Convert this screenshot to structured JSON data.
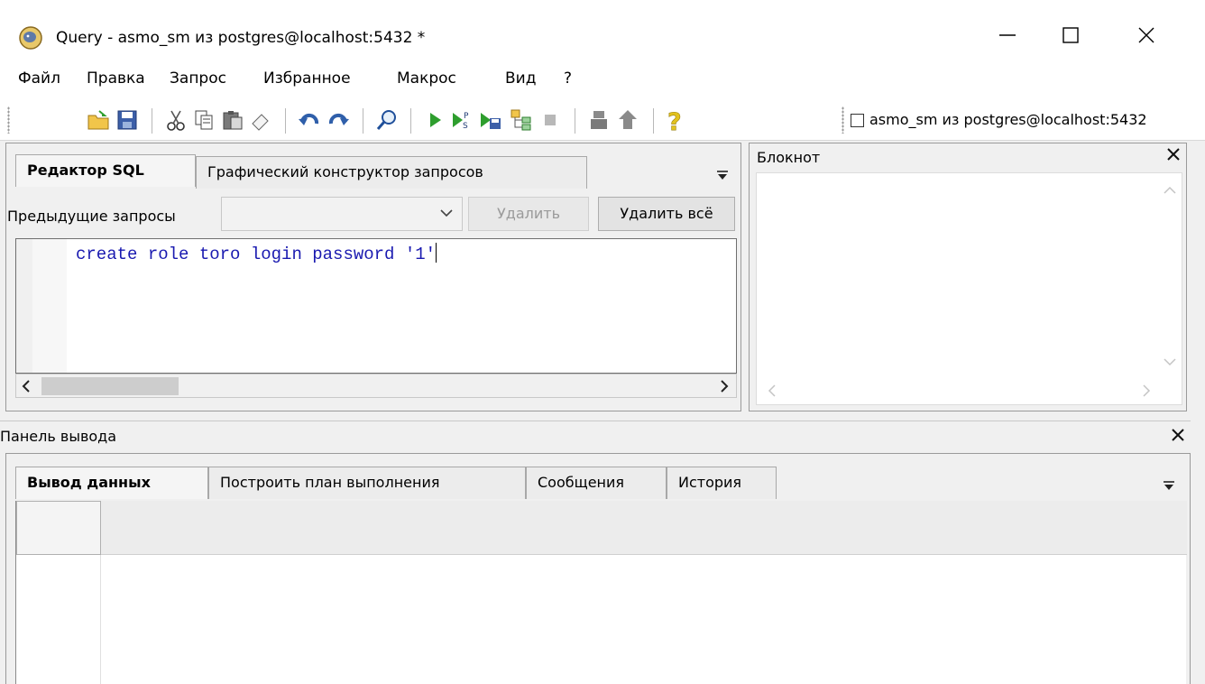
{
  "window": {
    "title": "Query - asmo_sm из postgres@localhost:5432 *"
  },
  "menu": {
    "items": [
      "Файл",
      "Правка",
      "Запрос",
      "Избранное",
      "Макрос",
      "Вид",
      "?"
    ]
  },
  "toolbar": {
    "connection_label": "asmo_sm из postgres@localhost:5432",
    "icons": [
      "open-file-icon",
      "save-icon",
      "cut-icon",
      "copy-icon",
      "paste-icon",
      "clear-icon",
      "undo-icon",
      "redo-icon",
      "find-icon",
      "execute-icon",
      "execute-pgscript-icon",
      "execute-to-file-icon",
      "explain-icon",
      "stop-icon",
      "commit-icon",
      "rollback-icon",
      "help-icon"
    ]
  },
  "sql_editor": {
    "tabs": [
      "Редактор SQL",
      "Графический конструктор запросов"
    ],
    "active_tab": "Редактор SQL",
    "history_label": "Предыдущие запросы",
    "history_value": "",
    "delete_label": "Удалить",
    "delete_all_label": "Удалить всё",
    "code": "create role toro login password '1'"
  },
  "notepad": {
    "title": "Блокнот"
  },
  "output": {
    "title": "Панель вывода",
    "tabs": [
      "Вывод данных",
      "Построить план выполнения",
      "Сообщения",
      "История"
    ],
    "active_tab": "Вывод данных"
  },
  "colors": {
    "code_text": "#1a1ab0",
    "toolbar_accent_green": "#2e9e2e"
  }
}
